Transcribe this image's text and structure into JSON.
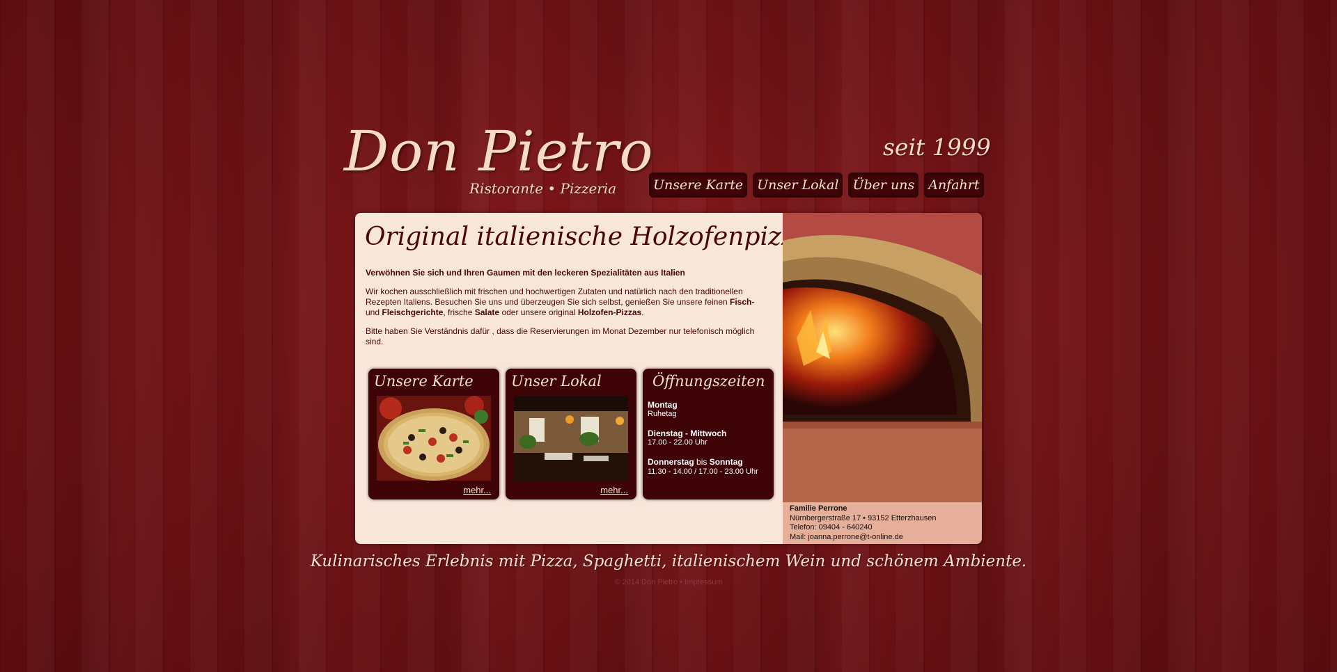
{
  "header": {
    "title": "Don Pietro",
    "subtitle": "Ristorante • Pizzeria",
    "since": "seit 1999"
  },
  "nav": [
    {
      "label": "Unsere Karte"
    },
    {
      "label": "Unser Lokal"
    },
    {
      "label": "Über uns"
    },
    {
      "label": "Anfahrt"
    }
  ],
  "main": {
    "headline": "Original italienische Holzofenpizzas",
    "lead": "Verwöhnen Sie sich und Ihren Gaumen mit den leckeren Spezialitäten aus Italien",
    "para1": {
      "t1": "Wir kochen ausschließlich mit frischen und hochwertigen Zutaten und natürlich nach den traditionellen Rezepten Italiens. Besuchen Sie uns und überzeugen Sie sich selbst, genießen Sie unsere feinen ",
      "b1": "Fisch-",
      "t2": " und ",
      "b2": "Fleischgerichte",
      "t3": ", frische ",
      "b3": "Salate",
      "t4": " oder unsere original ",
      "b4": "Holzofen-Pizzas",
      "t5": "."
    },
    "para2": "Bitte haben Sie Verständnis dafür , dass die Reservierungen im Monat Dezember nur telefonisch möglich sind."
  },
  "boxes": {
    "karte": {
      "title": "Unsere Karte",
      "more": "mehr..."
    },
    "lokal": {
      "title": "Unser Lokal",
      "more": "mehr..."
    },
    "hours": {
      "title": "Öffnungszeiten",
      "mon_day": "Montag",
      "mon_time": "Ruhetag",
      "tue_day": "Dienstag - Mittwoch",
      "tue_time": "17.00 - 22.00 Uhr",
      "thu_day1": "Donnerstag",
      "thu_mid": " bis ",
      "thu_day2": "Sonntag",
      "thu_time": "11.30 - 14.00  / 17.00 - 23.00 Uhr"
    }
  },
  "contact": {
    "name": "Familie Perrone",
    "address": "Nürnbergerstraße 17 • 93152 Etterzhausen",
    "phone": "Telefon: 09404 - 640240",
    "mail": "Mail: joanna.perrone@t-online.de"
  },
  "tagline": "Kulinarisches Erlebnis mit Pizza, Spaghetti, italienischem Wein und schönem Ambiente.",
  "footer": {
    "copyright": "© 2014 Don Pietro • ",
    "impressum": "Impressum"
  },
  "colors": {
    "background": "#6b0f12",
    "panel": "#f9e6da",
    "box": "#3e0407",
    "text": "#4a0508"
  }
}
